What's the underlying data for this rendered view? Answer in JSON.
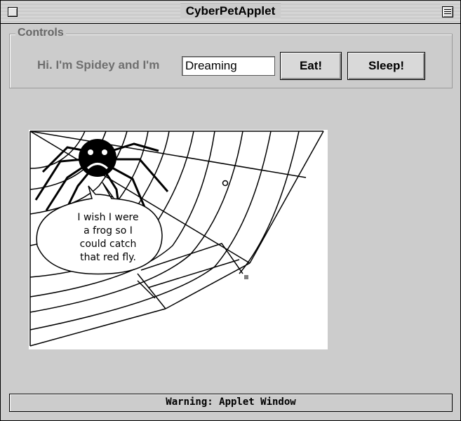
{
  "window": {
    "title": "CyberPetApplet"
  },
  "controls": {
    "legend": "Controls",
    "greeting": "Hi. I'm Spidey and I'm",
    "state_value": "Dreaming",
    "eat_label": "Eat!",
    "sleep_label": "Sleep!"
  },
  "scene": {
    "speech": [
      "I wish I were",
      "a frog so I",
      "could catch",
      "that red fly."
    ],
    "spider_mood": "sad"
  },
  "status": {
    "text": "Warning: Applet Window"
  }
}
